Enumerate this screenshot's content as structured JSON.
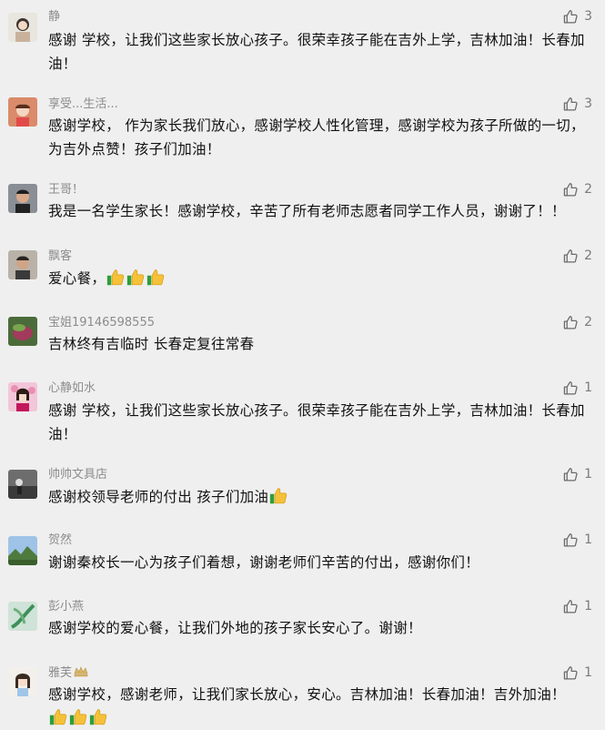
{
  "comments": [
    {
      "nickname": "静",
      "likes": "3",
      "text": "感谢 学校，让我们这些家长放心孩子。很荣幸孩子能在吉外上学，吉林加油！长春加油！",
      "emoji_count": 0
    },
    {
      "nickname": "享受...生活...",
      "likes": "3",
      "text": "感谢学校， 作为家长我们放心，感谢学校人性化管理，感谢学校为孩子所做的一切，为吉外点赞！孩子们加油！",
      "emoji_count": 0
    },
    {
      "nickname": "王哥！",
      "likes": "2",
      "text": "我是一名学生家长！感谢学校，辛苦了所有老师志愿者同学工作人员，谢谢了！！",
      "emoji_count": 0
    },
    {
      "nickname": "飘客",
      "likes": "2",
      "text": "爱心餐，",
      "emoji_count": 3
    },
    {
      "nickname": "宝姐19146598555",
      "likes": "2",
      "text": "吉林终有吉临时 长春定复往常春",
      "emoji_count": 0
    },
    {
      "nickname": "心静如水",
      "likes": "1",
      "text": "感谢 学校，让我们这些家长放心孩子。很荣幸孩子能在吉外上学，吉林加油！长春加油！",
      "emoji_count": 0
    },
    {
      "nickname": "帅帅文具店",
      "likes": "1",
      "text": "感谢校领导老师的付出 孩子们加油",
      "emoji_count": 1
    },
    {
      "nickname": "贺然",
      "likes": "1",
      "text": "谢谢秦校长一心为孩子们着想，谢谢老师们辛苦的付出，感谢你们！",
      "emoji_count": 0
    },
    {
      "nickname": "彭小燕",
      "likes": "1",
      "text": "感谢学校的爱心餐，让我们外地的孩子家长安心了。谢谢！",
      "emoji_count": 0
    },
    {
      "nickname": "雅芙",
      "likes": "1",
      "text": "感谢学校，感谢老师，让我们家长放心，安心。吉林加油！长春加油！吉外加油！",
      "emoji_count": 3
    }
  ],
  "icons": {
    "like": "thumbs-up-outline-icon",
    "emoji": "thumbs-up-emoji-icon",
    "crown": "crown-icon"
  },
  "colors": {
    "background": "#efefef",
    "nickname": "#8c8c8c",
    "text": "#111111",
    "like": "#7a7a7a"
  }
}
